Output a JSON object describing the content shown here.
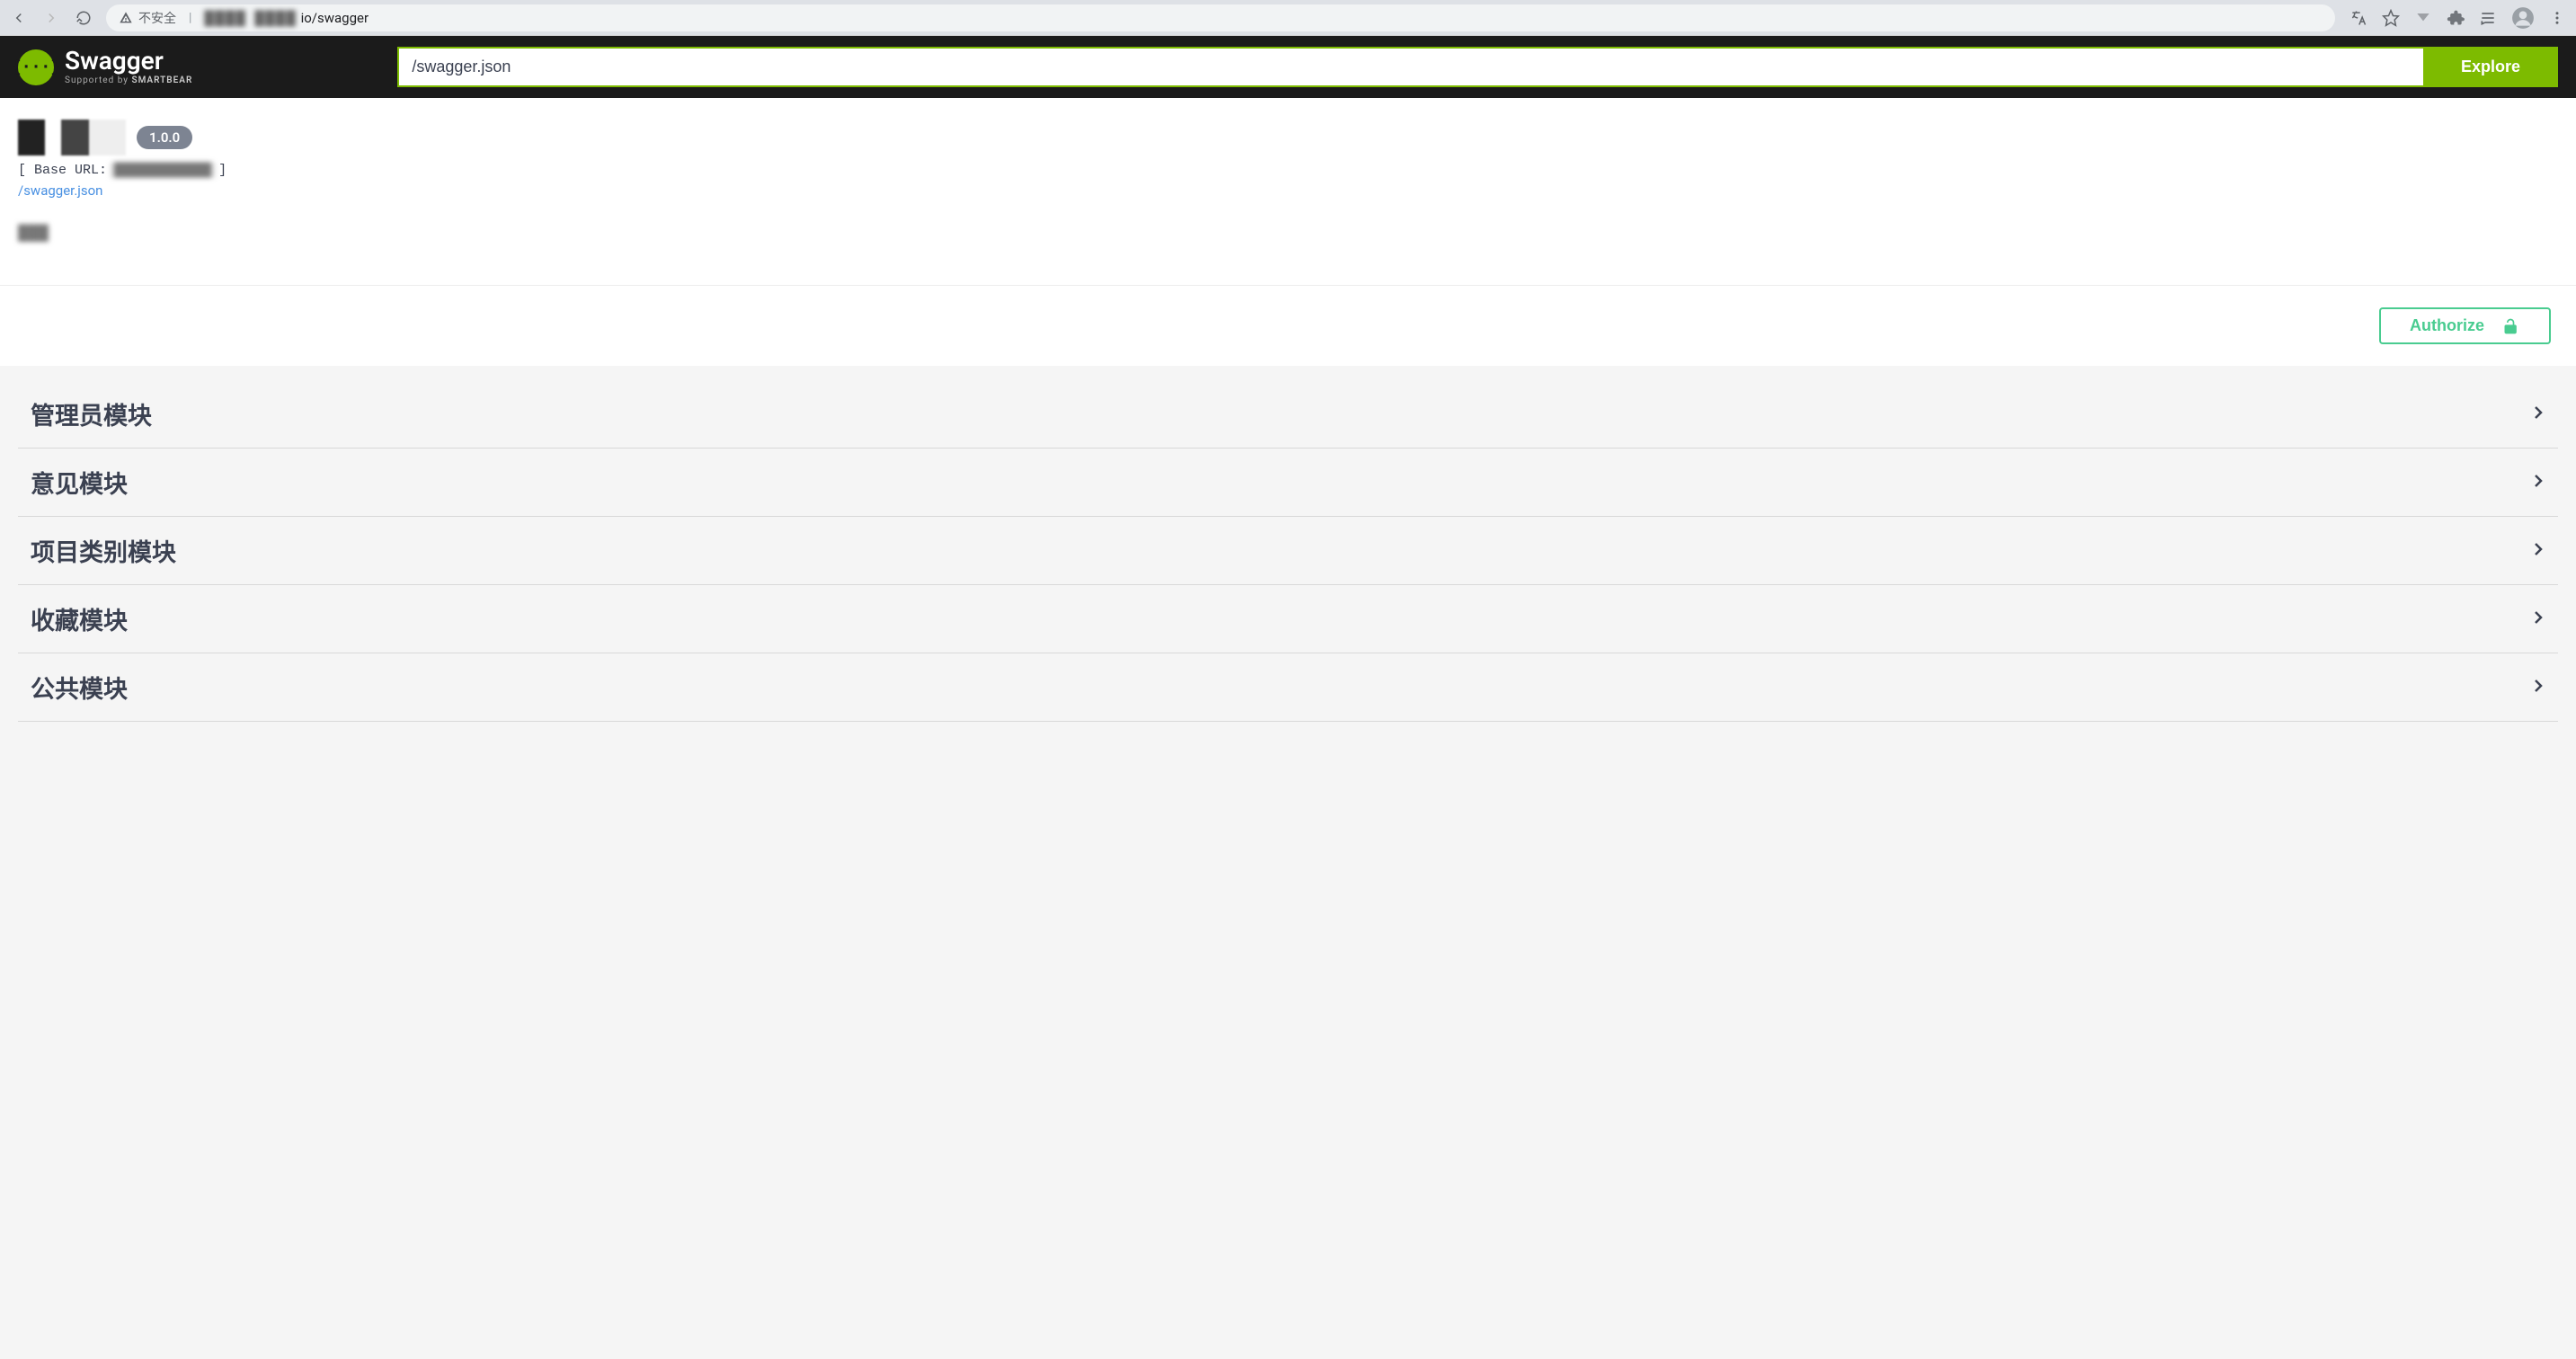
{
  "browser": {
    "security_label": "不安全",
    "url_suffix": "io/swagger"
  },
  "topbar": {
    "logo_text": "Swagger",
    "logo_subtext_prefix": "Supported by ",
    "logo_subtext_bold": "SMARTBEAR",
    "spec_input_value": "/swagger.json",
    "explore_label": "Explore"
  },
  "info": {
    "version": "1.0.0",
    "base_url_prefix": "[ Base URL:",
    "spec_link": "/swagger.json"
  },
  "authorize": {
    "label": "Authorize"
  },
  "tags": [
    {
      "name": "管理员模块"
    },
    {
      "name": "意见模块"
    },
    {
      "name": "项目类别模块"
    },
    {
      "name": "收藏模块"
    },
    {
      "name": "公共模块"
    }
  ]
}
